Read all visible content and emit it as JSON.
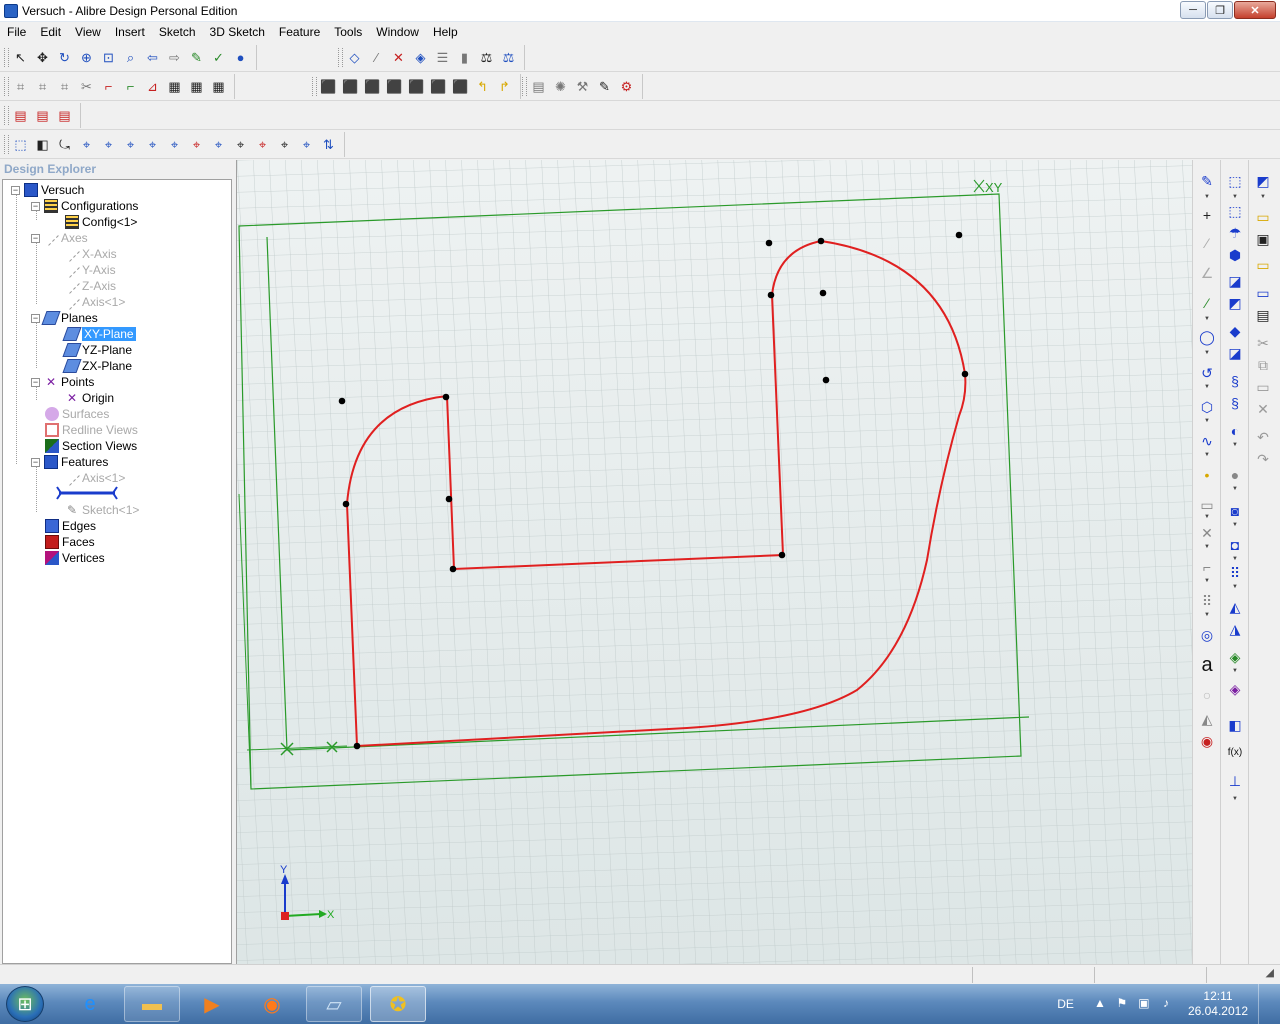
{
  "window": {
    "title": "Versuch - Alibre Design Personal Edition",
    "min_glyph": "─",
    "max_glyph": "❐",
    "close_glyph": "✕"
  },
  "menu": [
    "File",
    "Edit",
    "View",
    "Insert",
    "Sketch",
    "3D Sketch",
    "Feature",
    "Tools",
    "Window",
    "Help"
  ],
  "explorer": {
    "title": "Design Explorer",
    "tree": {
      "root": "Versuch",
      "configurations": "Configurations",
      "config1": "Config<1>",
      "axes": "Axes",
      "x_axis": "X-Axis",
      "y_axis": "Y-Axis",
      "z_axis": "Z-Axis",
      "axis1": "Axis<1>",
      "planes": "Planes",
      "xy_plane": "XY-Plane",
      "yz_plane": "YZ-Plane",
      "zx_plane": "ZX-Plane",
      "points": "Points",
      "origin": "Origin",
      "surfaces": "Surfaces",
      "redline_views": "Redline Views",
      "section_views": "Section Views",
      "features": "Features",
      "feature_axis1": "Axis<1>",
      "sketch1": "Sketch<1>",
      "edges": "Edges",
      "faces": "Faces",
      "vertices": "Vertices"
    }
  },
  "viewport": {
    "plane_label": "XY",
    "triad_x": "X",
    "triad_y": "Y",
    "colors": {
      "sketch": "#e02020",
      "plane": "#2a9a2a",
      "grid": "#b8c6c6",
      "triad_x": "#22aa22",
      "triad_y": "#1a3ccc",
      "triad_origin": "#dd2222"
    }
  },
  "right_toolbar": {
    "text_tool_glyph": "a",
    "function_tool_glyph": "f(x)"
  },
  "taskbar": {
    "language": "DE",
    "time": "12:11",
    "date": "26.04.2012"
  }
}
